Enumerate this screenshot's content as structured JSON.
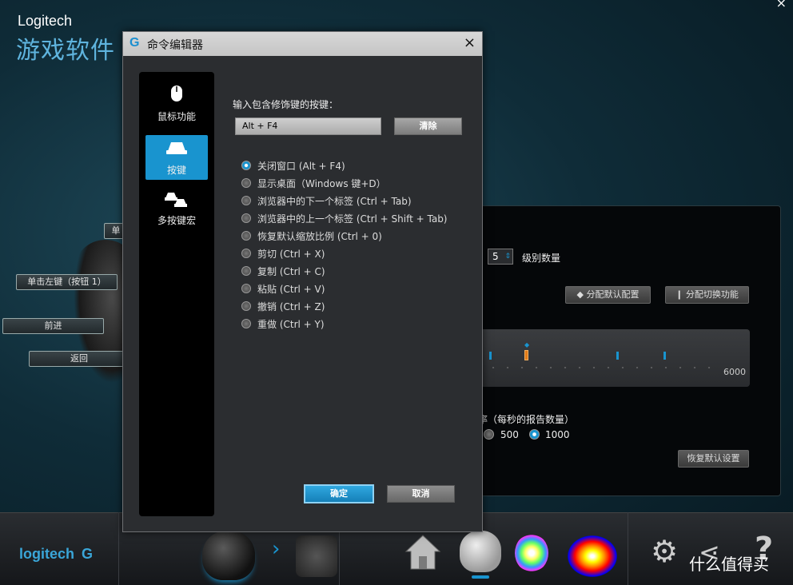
{
  "app": {
    "brand": "Logitech",
    "title": "游戏软件",
    "close_glyph": "×"
  },
  "background": {
    "pill_top": "单",
    "pill_left_click": "单击左键（按钮 1）",
    "pill_forward": "前进",
    "pill_back": "返回",
    "level_count_value": "5",
    "level_count_label": "级别数量",
    "btn_assign_default": "◆ 分配默认配置",
    "btn_assign_switch": "❙ 分配切换功能",
    "dpi_max_label": "6000",
    "report_rate_label": "率（每秒的报告数量）",
    "report_rate_options": [
      "500",
      "1000"
    ],
    "report_rate_selected": "1000",
    "btn_restore_default": "恢复默认设置"
  },
  "dialog": {
    "title": "命令编辑器",
    "close_label": "×",
    "side_items": [
      {
        "label": "鼠标功能",
        "icon": "mouse-icon",
        "active": false
      },
      {
        "label": "按键",
        "icon": "key-icon",
        "active": true
      },
      {
        "label": "多按键宏",
        "icon": "multikey-icon",
        "active": false
      }
    ],
    "input_label": "输入包含修饰键的按键：",
    "input_value": "Alt + F4",
    "clear_label": "清除",
    "options": [
      {
        "label": "关闭窗口 (Alt + F4)",
        "checked": true
      },
      {
        "label": "显示桌面（Windows 键+D）",
        "checked": false
      },
      {
        "label": "浏览器中的下一个标签 (Ctrl + Tab)",
        "checked": false
      },
      {
        "label": "浏览器中的上一个标签 (Ctrl + Shift + Tab)",
        "checked": false
      },
      {
        "label": "恢复默认缩放比例 (Ctrl + 0)",
        "checked": false
      },
      {
        "label": "剪切 (Ctrl + X)",
        "checked": false
      },
      {
        "label": "复制 (Ctrl + C)",
        "checked": false
      },
      {
        "label": "粘贴 (Ctrl + V)",
        "checked": false
      },
      {
        "label": "撤销 (Ctrl + Z)",
        "checked": false
      },
      {
        "label": "重做 (Ctrl + Y)",
        "checked": false
      }
    ],
    "ok_label": "确定",
    "cancel_label": "取消"
  },
  "taskbar": {
    "logo": "logitech",
    "watermark": "什么值得买"
  },
  "colors": {
    "accent": "#1994cf",
    "title_blue": "#5fb4de"
  }
}
